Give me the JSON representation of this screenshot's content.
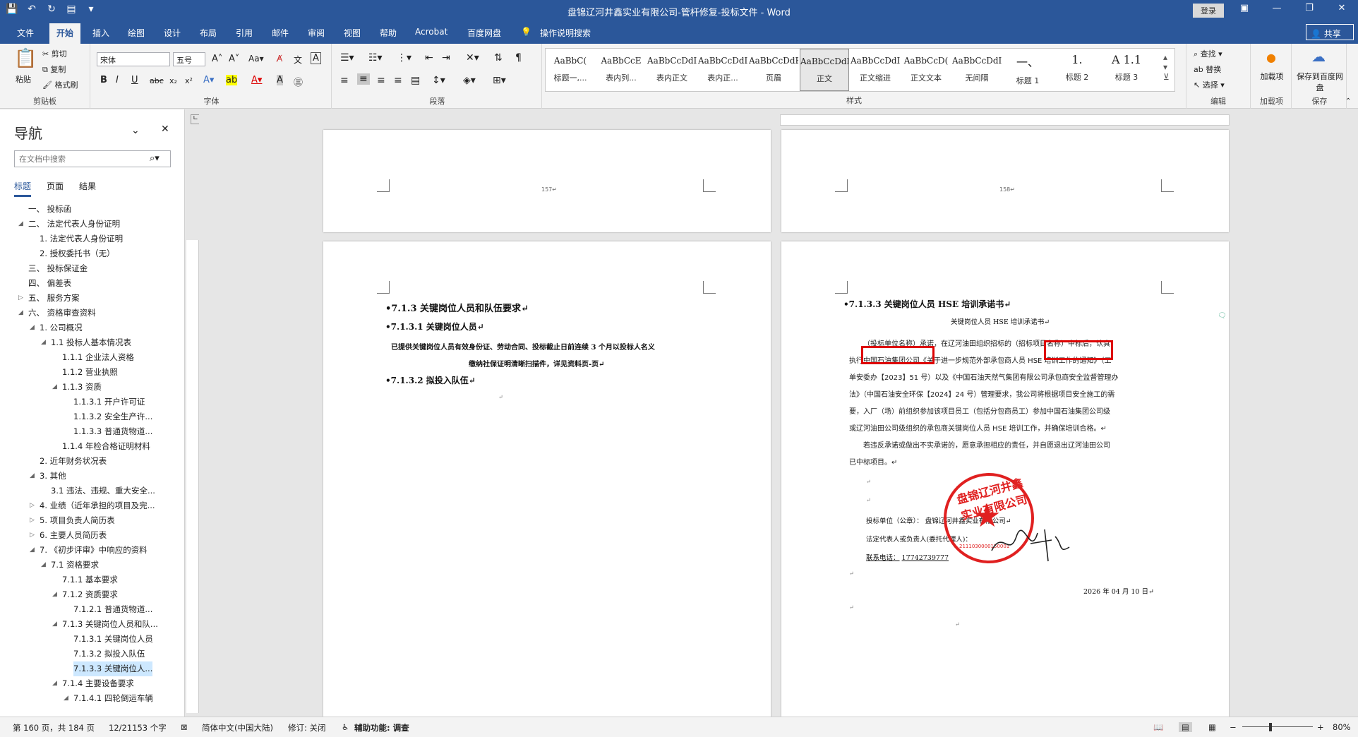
{
  "window": {
    "title": "盘锦辽河井鑫实业有限公司-管杆修复-投标文件  -  Word",
    "login": "登录",
    "share": "共享"
  },
  "tabs": [
    "文件",
    "开始",
    "插入",
    "绘图",
    "设计",
    "布局",
    "引用",
    "邮件",
    "审阅",
    "视图",
    "帮助",
    "Acrobat",
    "百度网盘",
    "操作说明搜索"
  ],
  "ribbon": {
    "clipboard": {
      "paste": "粘贴",
      "cut": "剪切",
      "copy": "复制",
      "format_painter": "格式刷",
      "label": "剪贴板"
    },
    "font": {
      "name": "宋体",
      "size": "五号",
      "label": "字体"
    },
    "paragraph": {
      "label": "段落"
    },
    "styles": {
      "label": "样式",
      "items": [
        {
          "preview": "AaBbC(",
          "name": "标题一,..."
        },
        {
          "preview": "AaBbCcE",
          "name": "表内列..."
        },
        {
          "preview": "AaBbCcDdI",
          "name": "表内正文"
        },
        {
          "preview": "AaBbCcDdI",
          "name": "表内正..."
        },
        {
          "preview": "AaBbCcDdEe",
          "name": "页眉"
        },
        {
          "preview": "AaBbCcDdI",
          "name": "正文"
        },
        {
          "preview": "AaBbCcDdI",
          "name": "正文缩进"
        },
        {
          "preview": "AaBbCcD(",
          "name": "正文文本"
        },
        {
          "preview": "AaBbCcDdI",
          "name": "无间隔"
        },
        {
          "preview": "一、",
          "name": "标题 1"
        },
        {
          "preview": "1.",
          "name": "标题 2"
        },
        {
          "preview": "A  1.1",
          "name": "标题 3"
        }
      ]
    },
    "editing": {
      "find": "查找",
      "replace": "替换",
      "select": "选择",
      "label": "编辑"
    },
    "addins": {
      "btn": "加载项",
      "label": "加载项"
    },
    "save": {
      "btn": "保存到百度网盘",
      "label": "保存"
    }
  },
  "nav": {
    "title": "导航",
    "search_placeholder": "在文档中搜索",
    "tabs": [
      "标题",
      "页面",
      "结果"
    ],
    "items": [
      {
        "text": "一、 投标函",
        "level": 0,
        "tri": ""
      },
      {
        "text": "二、 法定代表人身份证明",
        "level": 0,
        "tri": "◢"
      },
      {
        "text": "1. 法定代表人身份证明",
        "level": 1,
        "tri": ""
      },
      {
        "text": "2. 授权委托书（无）",
        "level": 1,
        "tri": ""
      },
      {
        "text": "三、 投标保证金",
        "level": 0,
        "tri": ""
      },
      {
        "text": "四、 偏差表",
        "level": 0,
        "tri": ""
      },
      {
        "text": "五、 服务方案",
        "level": 0,
        "tri": "▷"
      },
      {
        "text": "六、 资格审查资料",
        "level": 0,
        "tri": "◢"
      },
      {
        "text": "1. 公司概况",
        "level": 1,
        "tri": "◢"
      },
      {
        "text": "1.1 投标人基本情况表",
        "level": 2,
        "tri": "◢"
      },
      {
        "text": "1.1.1 企业法人资格",
        "level": 3,
        "tri": ""
      },
      {
        "text": "1.1.2 营业执照",
        "level": 3,
        "tri": ""
      },
      {
        "text": "1.1.3 资质",
        "level": 3,
        "tri": "◢"
      },
      {
        "text": "1.1.3.1 开户许可证",
        "level": 4,
        "tri": ""
      },
      {
        "text": "1.1.3.2 安全生产许...",
        "level": 4,
        "tri": ""
      },
      {
        "text": "1.1.3.3 普通货物道...",
        "level": 4,
        "tri": ""
      },
      {
        "text": "1.1.4 年检合格证明材料",
        "level": 3,
        "tri": ""
      },
      {
        "text": "2. 近年财务状况表",
        "level": 1,
        "tri": ""
      },
      {
        "text": "3. 其他",
        "level": 1,
        "tri": "◢"
      },
      {
        "text": "3.1 违法、违规、重大安全...",
        "level": 2,
        "tri": ""
      },
      {
        "text": "4. 业绩（近年承担的项目及完...",
        "level": 1,
        "tri": "▷"
      },
      {
        "text": "5. 项目负责人简历表",
        "level": 1,
        "tri": "▷"
      },
      {
        "text": "6. 主要人员简历表",
        "level": 1,
        "tri": "▷"
      },
      {
        "text": "7. 《初步评审》中响应的资料",
        "level": 1,
        "tri": "◢"
      },
      {
        "text": "7.1 资格要求",
        "level": 2,
        "tri": "◢"
      },
      {
        "text": "7.1.1 基本要求",
        "level": 3,
        "tri": ""
      },
      {
        "text": "7.1.2 资质要求",
        "level": 3,
        "tri": "◢"
      },
      {
        "text": "7.1.2.1 普通货物道...",
        "level": 4,
        "tri": ""
      },
      {
        "text": "7.1.3 关键岗位人员和队...",
        "level": 3,
        "tri": "◢"
      },
      {
        "text": "7.1.3.1 关键岗位人员",
        "level": 4,
        "tri": ""
      },
      {
        "text": "7.1.3.2 拟投入队伍",
        "level": 4,
        "tri": ""
      },
      {
        "text": "7.1.3.3 关键岗位人...",
        "level": 4,
        "tri": "",
        "selected": true
      },
      {
        "text": "7.1.4 主要设备要求",
        "level": 3,
        "tri": "◢"
      },
      {
        "text": "7.1.4.1 四轮倒运车辆",
        "level": 4,
        "tri": "◢"
      }
    ]
  },
  "pages": {
    "p157": "157↵",
    "p158": "158↵",
    "left": {
      "h1": "•7.1.3 关键岗位人员和队伍要求↵",
      "h2": "•7.1.3.1    关键岗位人员↵",
      "t1": "已提供关键岗位人员有效身份证、劳动合同、投标截止日前连续 3 个月以投标人名义",
      "t2": "缴纳社保证明清晰扫描件，详见资料页-页↵",
      "h3": "•7.1.3.2    拟投入队伍↵",
      "end": "↵"
    },
    "right": {
      "h1": "•7.1.3.3    关键岗位人员 HSE 培训承诺书↵",
      "subtitle": "关键岗位人员 HSE 培训承诺书↵",
      "lines": [
        "（投标单位名称）承诺，在辽河油田组织招标的（招标项目名称）中标后，认真",
        "执行中国石油集团公司《关于进一步规范外部承包商人员 HSE 培训工作的通知》（工",
        "单安委办【2023】51 号）以及《中国石油天然气集团有限公司承包商安全监督管理办",
        "法》（中国石油安全环保【2024】24 号）管理要求，我公司将根据项目安全施工的需",
        "要，入厂（场）前组织参加该项目员工（包括分包商员工）参加中国石油集团公司级",
        "或辽河油田公司级组织的承包商关键岗位人员 HSE 培训工作，并确保培训合格。↵",
        "若违反承诺或做出不实承诺的，愿意承担相应的责任，并自愿退出辽河油田公司",
        "已中标项目。↵"
      ],
      "blank1": "↵",
      "blank2": "↵",
      "bidder": "投标单位（公章）：  盘锦辽河井鑫实业有限公司↵",
      "legal": "法定代表人或负责人(委托代理人)：",
      "phone_label": "联系电话：",
      "phone": "17742739777",
      "blank3": "↵",
      "date": "2026 年  04  月  10  日↵",
      "blank4": "↵",
      "end": "↵",
      "seal_text": "盘锦辽河井鑫实业有限公司",
      "seal_num": "2111030000150001"
    }
  },
  "status": {
    "page": "第 160 页，共 184 页",
    "words": "12/21153 个字",
    "lang": "简体中文(中国大陆)",
    "track": "修订: 关闭",
    "access": "辅助功能: 调查",
    "zoom": "80%"
  },
  "colors": {
    "brand": "#2b579a",
    "highlight": "#dd0000",
    "seal": "#e02020"
  }
}
